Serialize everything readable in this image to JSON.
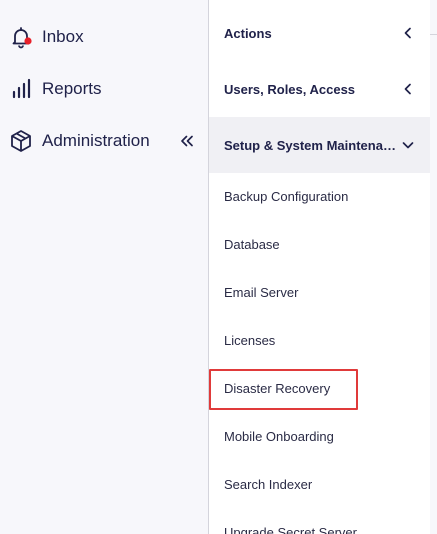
{
  "nav": {
    "items": [
      {
        "label": "Inbox",
        "icon": "bell-icon"
      },
      {
        "label": "Reports",
        "icon": "bar-chart-icon"
      },
      {
        "label": "Administration",
        "icon": "box-icon"
      }
    ],
    "collapse_icon": "double-chevron-left-icon"
  },
  "menu": {
    "groups": [
      {
        "label": "Actions",
        "state": "collapsed"
      },
      {
        "label": "Users, Roles, Access",
        "state": "collapsed"
      },
      {
        "label": "Setup & System Maintenance",
        "state": "expanded"
      }
    ],
    "items": [
      "Backup Configuration",
      "Database",
      "Email Server",
      "Licenses",
      "Disaster Recovery",
      "Mobile Onboarding",
      "Search Indexer",
      "Upgrade Secret Server"
    ],
    "highlighted_item": "Disaster Recovery"
  },
  "colors": {
    "text_dark": "#20224a",
    "accent_red": "#e03a3a",
    "notification_dot": "#e8202a",
    "highlight_border": "#e03a3a"
  }
}
